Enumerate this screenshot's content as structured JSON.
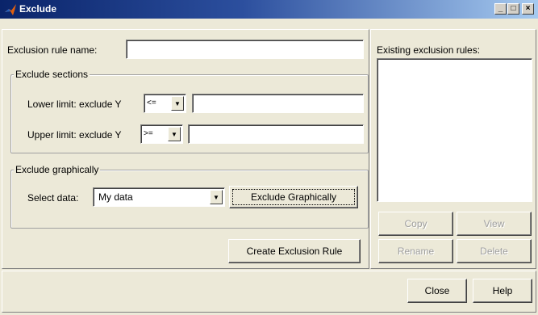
{
  "window": {
    "title": "Exclude",
    "minimize": "_",
    "maximize": "□",
    "close": "×"
  },
  "left": {
    "rule_name_label": "Exclusion rule name:",
    "rule_name_value": "",
    "sections": {
      "legend": "Exclude sections",
      "lower_label": "Lower limit: exclude Y",
      "lower_op": "<=",
      "lower_value": "",
      "upper_label": "Upper limit: exclude Y",
      "upper_op": ">=",
      "upper_value": ""
    },
    "graphical": {
      "legend": "Exclude graphically",
      "select_label": "Select data:",
      "select_value": "My data",
      "exclude_button": "Exclude Graphically"
    },
    "create_button": "Create Exclusion Rule"
  },
  "right": {
    "existing_label": "Existing exclusion rules:",
    "copy": "Copy",
    "view": "View",
    "rename": "Rename",
    "delete": "Delete"
  },
  "footer": {
    "close": "Close",
    "help": "Help"
  },
  "colors": {
    "title_start": "#0a246a",
    "title_end": "#a6caf0",
    "face": "#ece9d8"
  },
  "icons": {
    "app": "matlab-membrane-icon",
    "dropdown": "chevron-down-icon"
  }
}
